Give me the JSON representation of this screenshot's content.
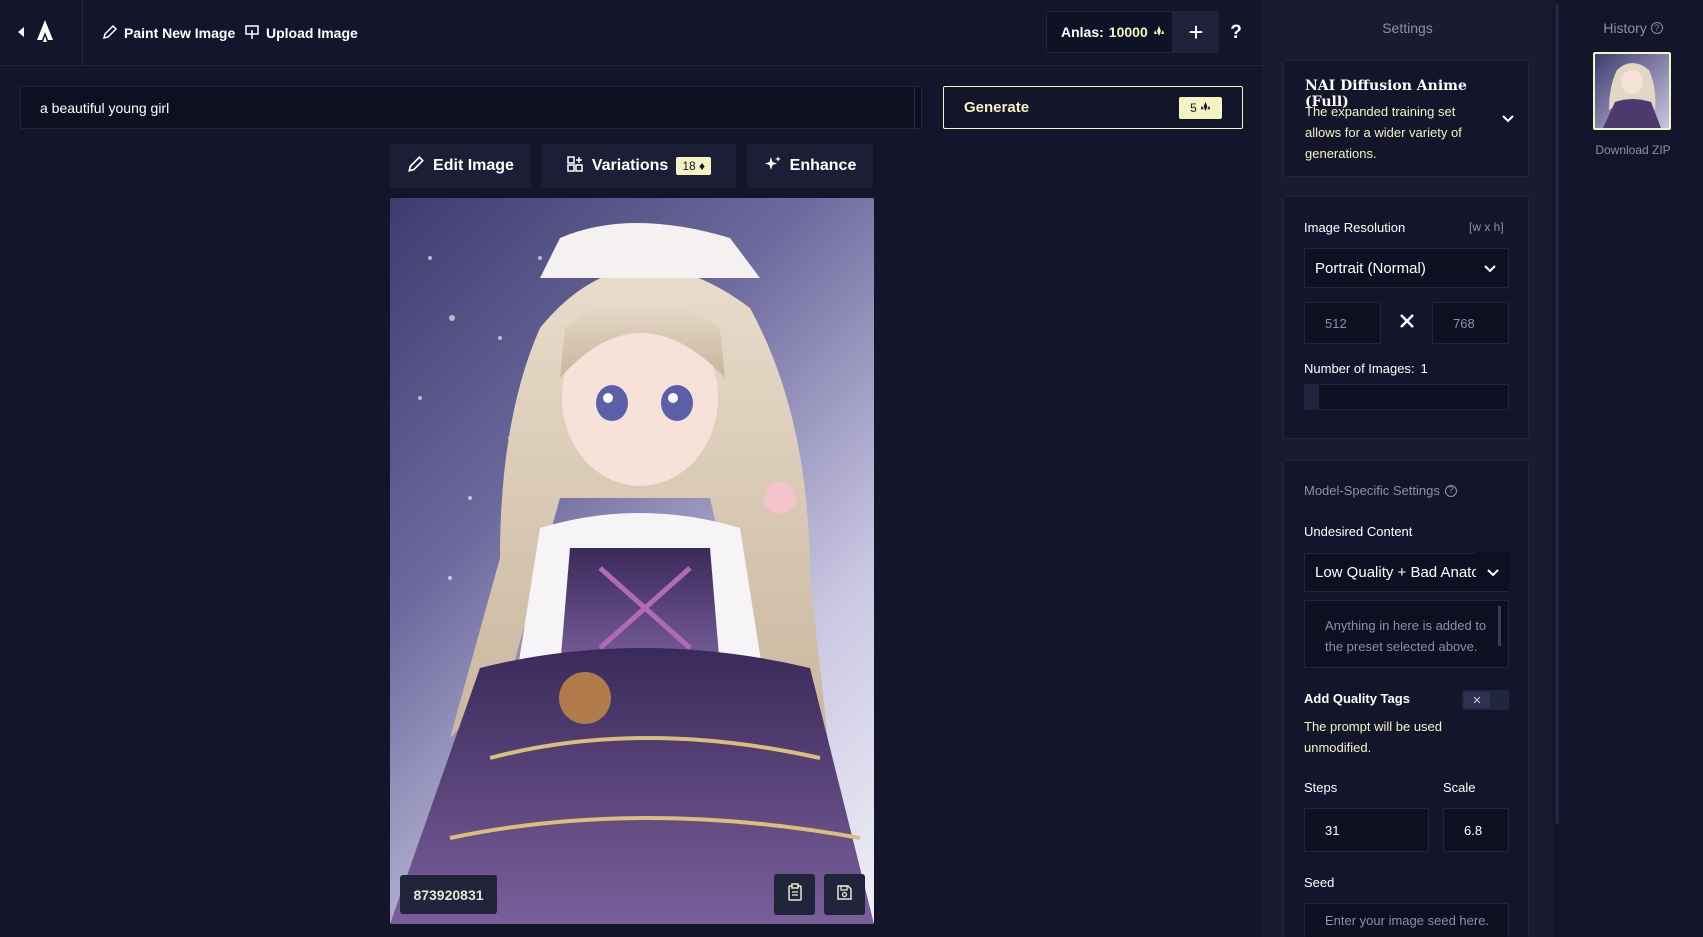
{
  "toolbar": {
    "paint_label": "Paint New Image",
    "upload_label": "Upload Image",
    "anlas_label": "Anlas:",
    "anlas_value": "10000",
    "plus_label": "+",
    "help_label": "?"
  },
  "prompt": {
    "value": "a beautiful young girl"
  },
  "generate": {
    "label": "Generate",
    "cost": "5"
  },
  "tools": {
    "edit_label": "Edit Image",
    "variations_label": "Variations",
    "variations_cost": "18",
    "enhance_label": "Enhance"
  },
  "image": {
    "seed": "873920831"
  },
  "settings": {
    "title": "Settings",
    "model": {
      "name": "NAI Diffusion Anime (Full)",
      "description": "The expanded training set allows for a wider variety of generations."
    },
    "resolution": {
      "label": "Image Resolution",
      "hint": "[w x h]",
      "preset": "Portrait (Normal)",
      "width": "512",
      "height": "768"
    },
    "num_images": {
      "label": "Number of Images:",
      "value": "1",
      "fraction": 0.07
    },
    "model_specific": {
      "title": "Model-Specific Settings"
    },
    "undesired": {
      "label": "Undesired Content",
      "preset": "Low Quality + Bad Anato",
      "placeholder": "Anything in here is added to the preset selected above."
    },
    "quality_tags": {
      "label": "Add Quality Tags",
      "enabled": false,
      "description": "The prompt will be used unmodified."
    },
    "steps": {
      "label": "Steps",
      "value": "31"
    },
    "scale": {
      "label": "Scale",
      "value": "6.8"
    },
    "seed": {
      "label": "Seed",
      "placeholder": "Enter your image seed here."
    }
  },
  "history": {
    "title": "History",
    "download_label": "Download ZIP"
  },
  "colors": {
    "accent": "#f5f3c2",
    "background": "#13152b",
    "panel": "#191b31"
  }
}
